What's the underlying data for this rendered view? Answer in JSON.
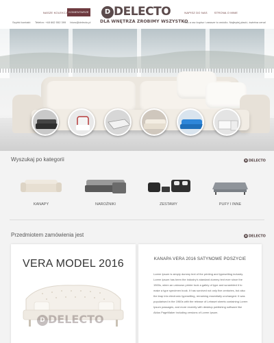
{
  "header": {
    "nav_left": [
      "Nasze kolekcje",
      "Komentarze"
    ],
    "nav_right": [
      "Napisz do nas",
      "Strona o mnie"
    ],
    "contact_label": "Szybki kontakt:",
    "phone": "Telefon: +48 662 552 399",
    "email": "biuro@delecto.pl",
    "motto": "Raz a raz kupisz i zawsze to wróciło. Najlepiej płacić, świetna cena!",
    "logo_text": "DELECTO",
    "logo_letter": "D",
    "logo_tagline": "DLA WNĘTRZA ZROBIMY WSZYSTKO"
  },
  "hero": {
    "thumbnails": [
      "sofa-gray-icon",
      "armchair-icon",
      "corner-sofa-icon",
      "white-sofa-icon",
      "blue-sofa-icon",
      "corner-lounge-icon"
    ]
  },
  "categories": {
    "title": "Wyszukaj po kategorii",
    "items": [
      {
        "label": "KANAPY",
        "icon": "sofa-icon"
      },
      {
        "label": "NAROŻNIKI",
        "icon": "corner-sofa-icon"
      },
      {
        "label": "ZESTAWY",
        "icon": "sofa-set-icon"
      },
      {
        "label": "PUFY I INNE",
        "icon": "ottoman-icon"
      }
    ]
  },
  "product": {
    "section_title": "Przedmiotem zamówienia jest",
    "name": "VERA MODEL 2016",
    "heading": "KANAPA VERA 2016 SATYNOWE POSZYCIE",
    "description": "Lorem Ipsum is simply dummy text of the printing and typesetting industry. Lorem Ipsum has been the industry's standard dummy text ever since the 1500s, when an unknown printer took a galley of type and scrambled it to make a type specimen book. It has survived not only five centuries, but also the leap into electronic typesetting, remaining essentially unchanged. It was popularised in the 1960s with the release of Letraset sheets containing Lorem Ipsum passages, and more recently with desktop publishing software like Aldus PageMaker including versions of Lorem Ipsum.",
    "watermark": "DELECTO"
  },
  "mini_logo": "DELECTO",
  "colors": {
    "brand": "#5b4a4b",
    "accent": "#6e3a3f",
    "background": "#f3f3f3"
  }
}
